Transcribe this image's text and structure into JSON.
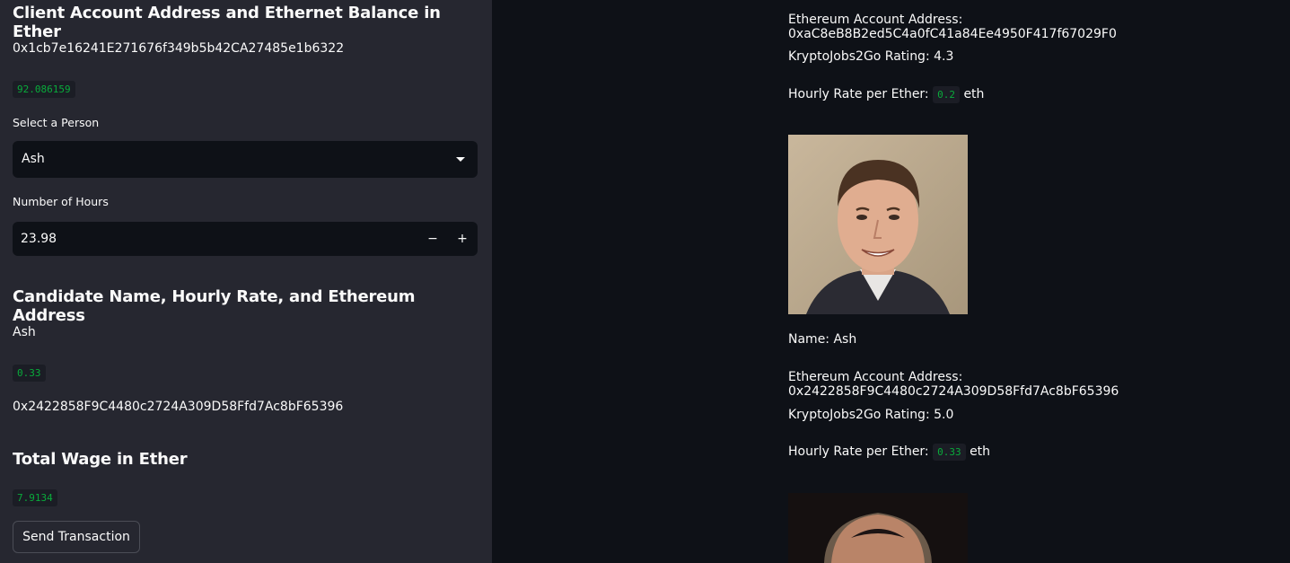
{
  "sidebar": {
    "client_header": "Client Account Address and Ethernet Balance in Ether",
    "client_address": "0x1cb7e16241E271676f349b5b42CA27485e1b6322",
    "client_balance": "92.086159",
    "select_label": "Select a Person",
    "select_value": "Ash",
    "hours_label": "Number of Hours",
    "hours_value": "23.98",
    "minus": "−",
    "plus": "+",
    "candidate_header": "Candidate Name, Hourly Rate, and Ethereum Address",
    "candidate_name": "Ash",
    "candidate_rate": "0.33",
    "candidate_address": "0x2422858F9C4480c2724A309D58Ffd7Ac8bF65396",
    "wage_header": "Total Wage in Ether",
    "wage_value": "7.9134",
    "send_button": "Send Transaction"
  },
  "main": {
    "candidates": [
      {
        "address": "Ethereum Account Address: 0xaC8eB8B2ed5C4a0fC41a84Ee4950F417f67029F0",
        "rating": "KryptoJobs2Go Rating: 4.3",
        "rate_label": "Hourly Rate per Ether:",
        "rate": "0.2",
        "unit": "eth"
      },
      {
        "name": "Name: Ash",
        "address": "Ethereum Account Address: 0x2422858F9C4480c2724A309D58Ffd7Ac8bF65396",
        "rating": "KryptoJobs2Go Rating: 5.0",
        "rate_label": "Hourly Rate per Ether:",
        "rate": "0.33",
        "unit": "eth"
      }
    ]
  }
}
